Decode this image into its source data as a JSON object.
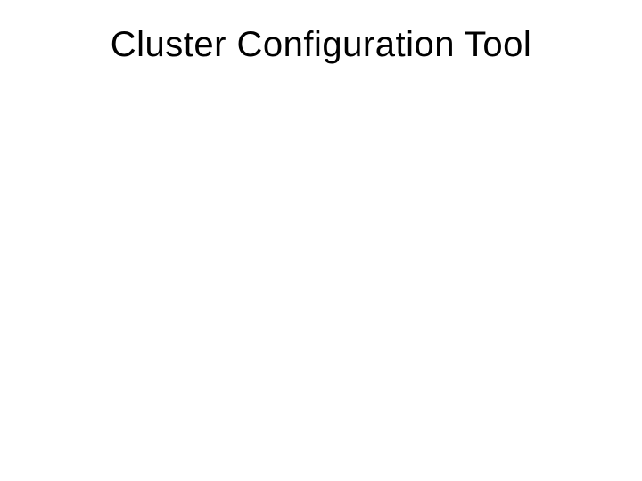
{
  "slide": {
    "title": "Cluster Configuration Tool"
  }
}
